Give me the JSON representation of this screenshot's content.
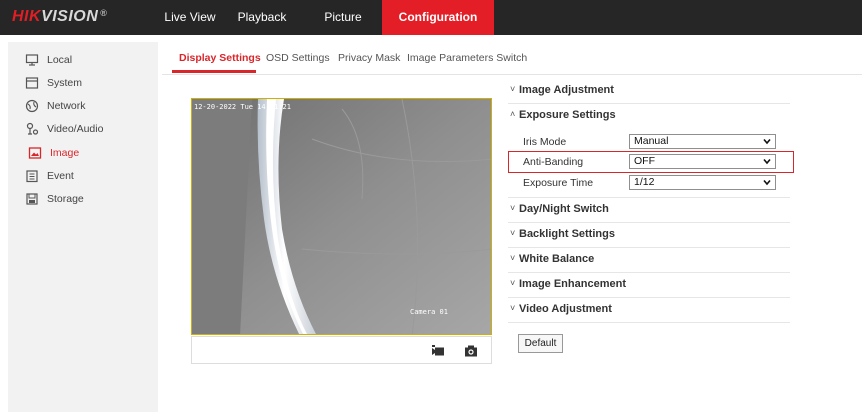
{
  "brand": {
    "hik": "HIK",
    "vision": "VISION",
    "reg": "®"
  },
  "topnav": {
    "live_view": "Live View",
    "playback": "Playback",
    "picture": "Picture",
    "configuration": "Configuration"
  },
  "sidebar": {
    "items": [
      {
        "label": "Local",
        "icon": "monitor-icon"
      },
      {
        "label": "System",
        "icon": "system-icon"
      },
      {
        "label": "Network",
        "icon": "network-icon"
      },
      {
        "label": "Video/Audio",
        "icon": "video-audio-icon"
      },
      {
        "label": "Image",
        "icon": "image-icon",
        "active": true
      },
      {
        "label": "Event",
        "icon": "event-icon"
      },
      {
        "label": "Storage",
        "icon": "storage-icon"
      }
    ]
  },
  "subtabs": {
    "display_settings": "Display Settings",
    "osd_settings": "OSD Settings",
    "privacy_mask": "Privacy Mask",
    "image_parameters_switch": "Image Parameters Switch"
  },
  "video": {
    "timestamp": "12-20-2022 Tue 14:51:21",
    "camera_name": "Camera 01"
  },
  "panel": {
    "image_adjustment": "Image Adjustment",
    "exposure_settings": "Exposure Settings",
    "iris_mode_label": "Iris Mode",
    "iris_mode_value": "Manual",
    "anti_banding_label": "Anti-Banding",
    "anti_banding_value": "OFF",
    "exposure_time_label": "Exposure Time",
    "exposure_time_value": "1/12",
    "day_night_switch": "Day/Night Switch",
    "backlight_settings": "Backlight Settings",
    "white_balance": "White Balance",
    "image_enhancement": "Image Enhancement",
    "video_adjustment": "Video Adjustment",
    "default_button": "Default"
  },
  "colors": {
    "accent": "#e41e26",
    "topbar": "#262626",
    "sidebar_bg": "#f2f2f2"
  }
}
